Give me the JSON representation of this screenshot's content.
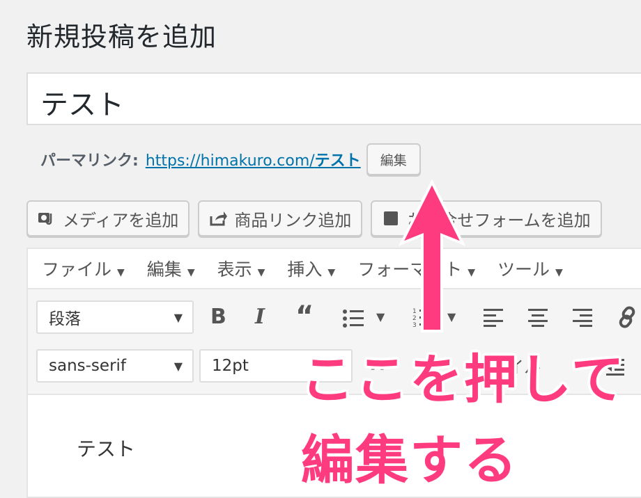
{
  "page": {
    "title": "新規投稿を追加"
  },
  "post_title": {
    "value": "テスト"
  },
  "permalink": {
    "label": "パーマリンク:",
    "url_prefix": "https://himakuro.com/",
    "url_slug": "テスト",
    "edit_label": "編集"
  },
  "media_buttons": [
    {
      "label": "メディアを追加",
      "icon": "media-icon"
    },
    {
      "label": "商品リンク追加",
      "icon": "share-icon"
    },
    {
      "label": "お問合せフォームを追加",
      "icon": "form-icon"
    }
  ],
  "menubar": [
    "ファイル",
    "編集",
    "表示",
    "挿入",
    "フォーマット",
    "ツール"
  ],
  "toolbar": {
    "format_select": "段落",
    "font_family_select": "sans-serif",
    "font_size_select": "12pt",
    "style_fragment": "スタイル"
  },
  "content": {
    "text": "テスト"
  },
  "annotation": {
    "line1": "ここを押して",
    "line2": "編集する"
  },
  "colors": {
    "annotation": "#ff3b7f",
    "link": "#0073aa"
  }
}
